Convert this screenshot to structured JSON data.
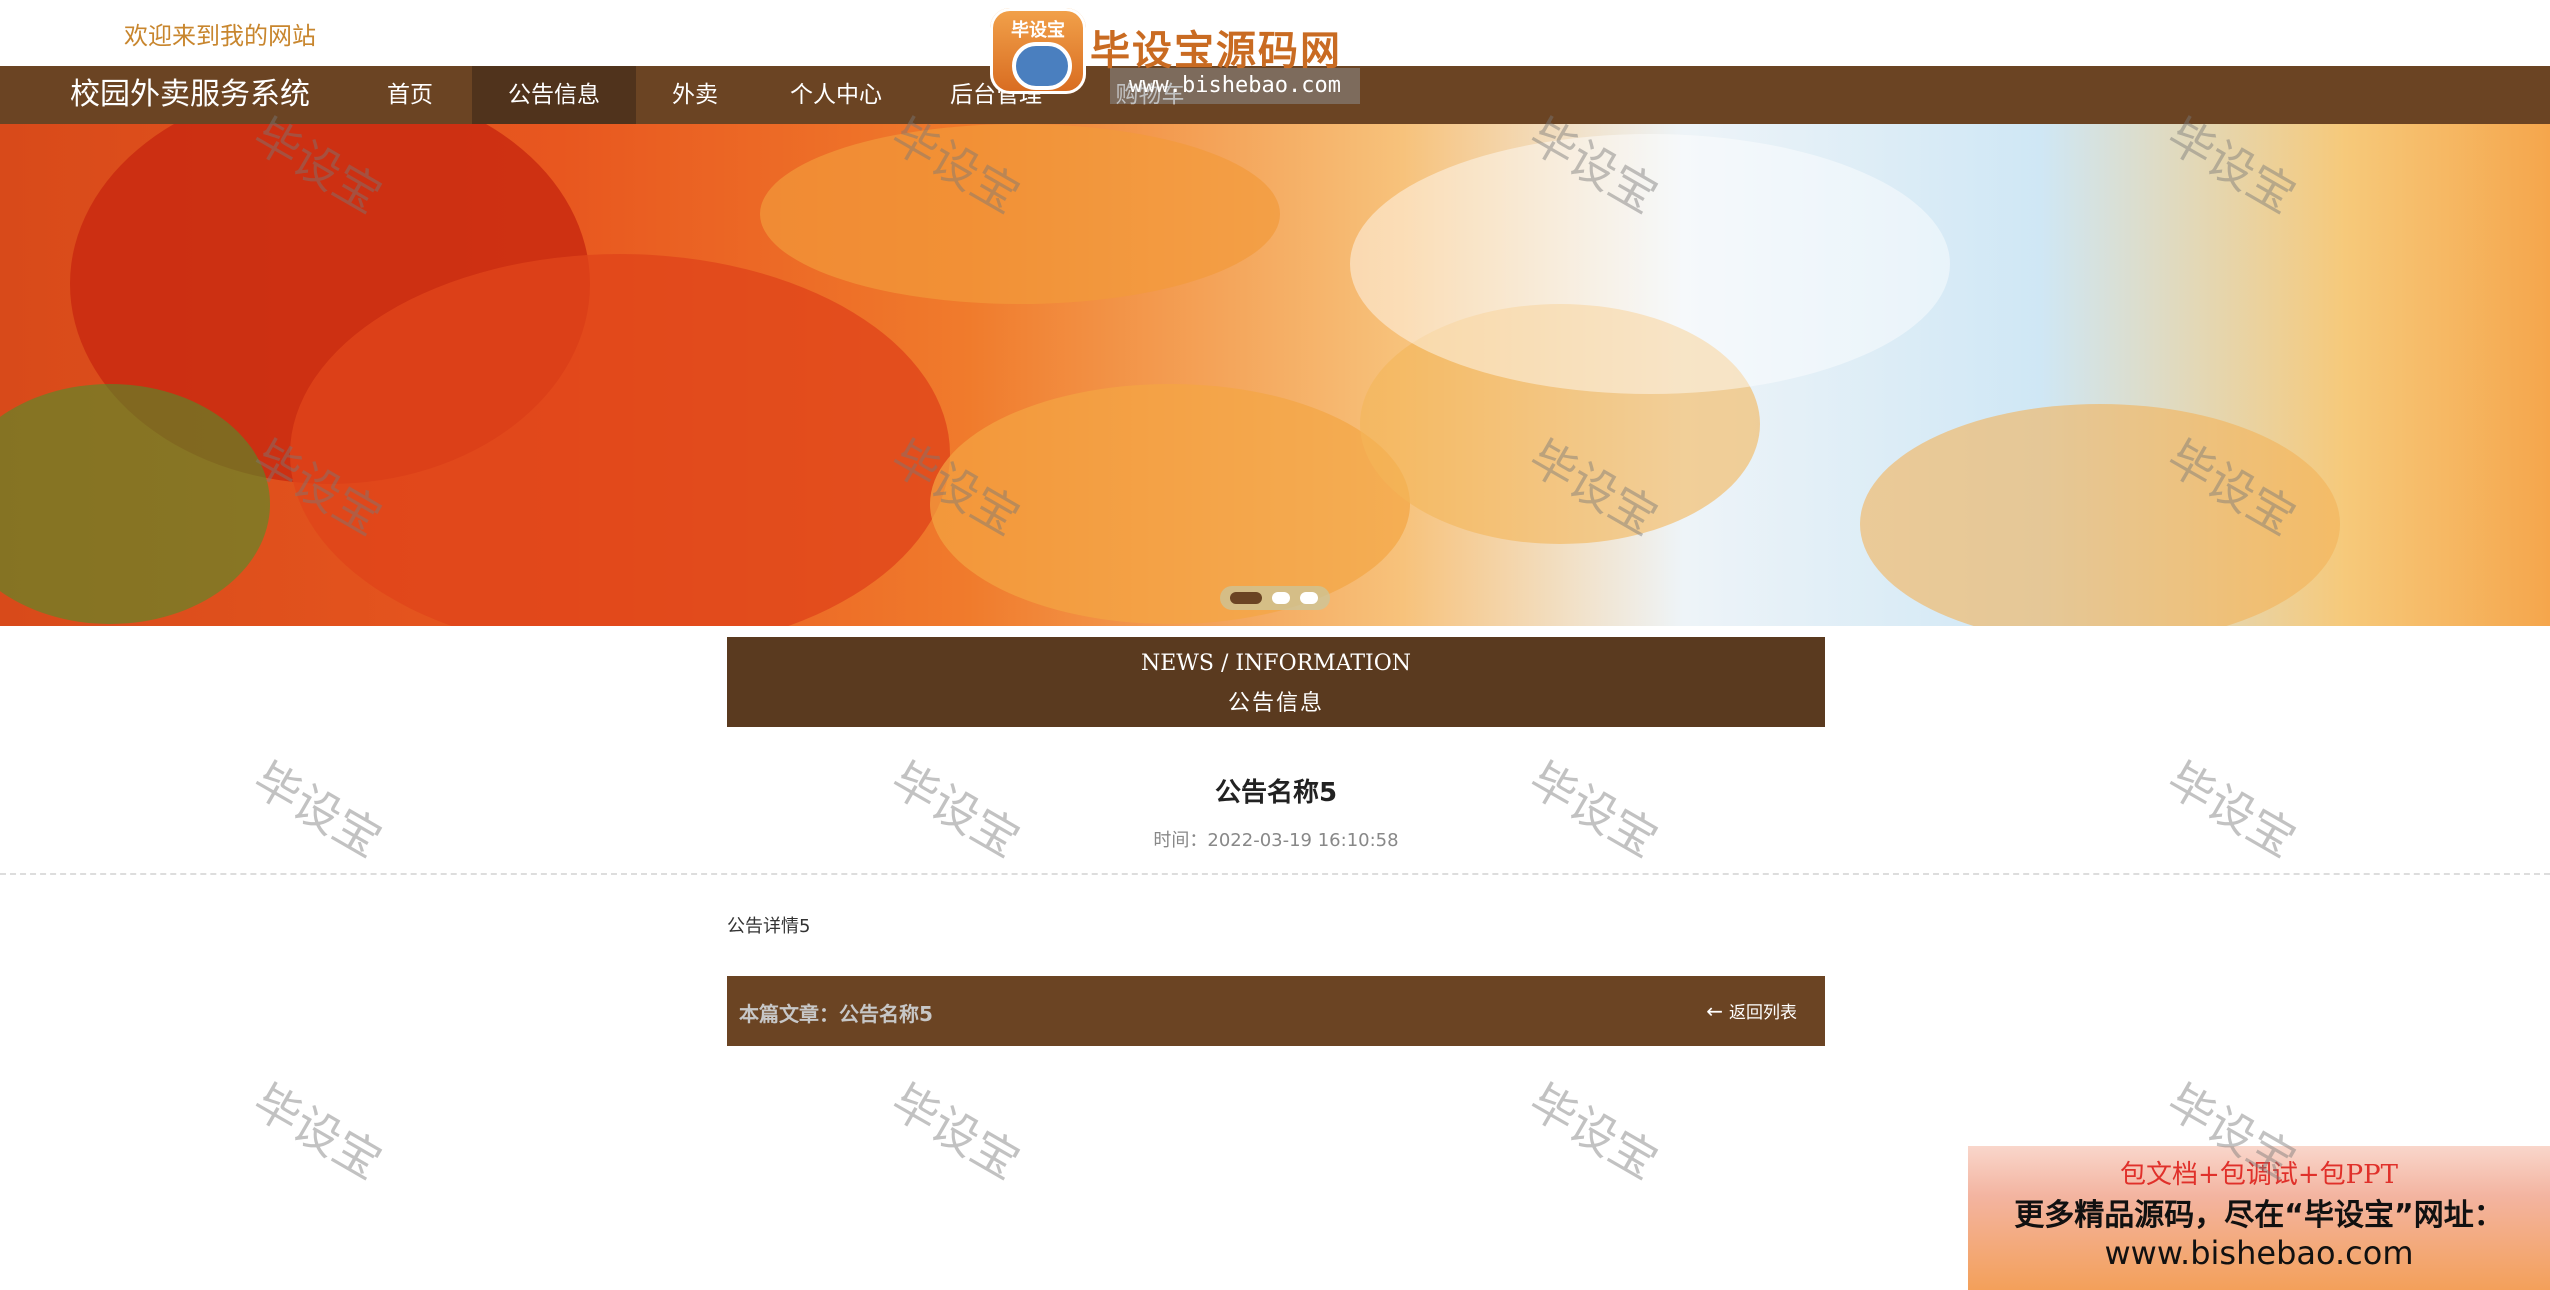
{
  "header": {
    "welcome_text": "欢迎来到我的网站"
  },
  "nav": {
    "brand": "校园外卖服务系统",
    "items": [
      {
        "label": "首页"
      },
      {
        "label": "公告信息"
      },
      {
        "label": "外卖"
      },
      {
        "label": "个人中心"
      },
      {
        "label": "后台管理"
      },
      {
        "label": "购物车"
      }
    ],
    "active_index": 1
  },
  "watermark": {
    "logo_badge": "毕设宝",
    "logo_title": "毕设宝源码网",
    "logo_url": "www.bishebao.com",
    "tile_text": "毕设宝"
  },
  "carousel": {
    "slide_count": 3,
    "active_slide": 0
  },
  "news_header": {
    "english": "NEWS / INFORMATION",
    "chinese": "公告信息"
  },
  "article": {
    "title": "公告名称5",
    "time": "时间：2022-03-19 16:10:58",
    "body": "公告详情5",
    "footer_label": "本篇文章：公告名称5",
    "back_label": "返回列表"
  },
  "ad": {
    "line1": "包文档+包调试+包PPT",
    "line2": "更多精品源码，尽在“毕设宝”网址：",
    "line3": "www.bishebao.com"
  },
  "colors": {
    "nav_bg": "#6b4423",
    "nav_active": "#50331c",
    "news_header_bg": "#5a3a1f",
    "welcome": "#c8862e"
  }
}
